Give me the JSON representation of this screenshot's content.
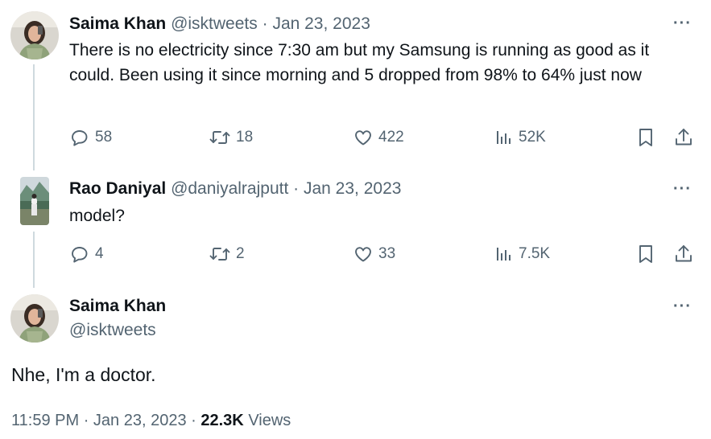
{
  "tweets": [
    {
      "name": "Saima Khan",
      "handle": "@isktweets",
      "separator": "·",
      "date": "Jan 23, 2023",
      "text": "There is no electricity since 7:30 am but my Samsung is running as good as it could. Been using it since morning and 5 dropped from 98% to 64% just now",
      "replies": "58",
      "reposts": "18",
      "likes": "422",
      "views": "52K"
    },
    {
      "name": "Rao Daniyal",
      "handle": "@daniyalrajputt",
      "separator": "·",
      "date": "Jan 23, 2023",
      "text": "model?",
      "replies": "4",
      "reposts": "2",
      "likes": "33",
      "views": "7.5K"
    }
  ],
  "main": {
    "name": "Saima Khan",
    "handle": "@isktweets",
    "text": "Nhe, I'm a doctor.",
    "time": "11:59 PM",
    "separator": "·",
    "date": "Jan 23, 2023",
    "separator2": "·",
    "views_count": "22.3K",
    "views_label": "Views"
  },
  "more_label": "···",
  "icons": {
    "reply": "reply-icon",
    "repost": "repost-icon",
    "like": "heart-icon",
    "views": "views-icon",
    "bookmark": "bookmark-icon",
    "share": "share-icon",
    "more": "more-icon"
  },
  "colors": {
    "text": "#0f1419",
    "muted": "#536471",
    "thread_line": "#cfd9de"
  }
}
